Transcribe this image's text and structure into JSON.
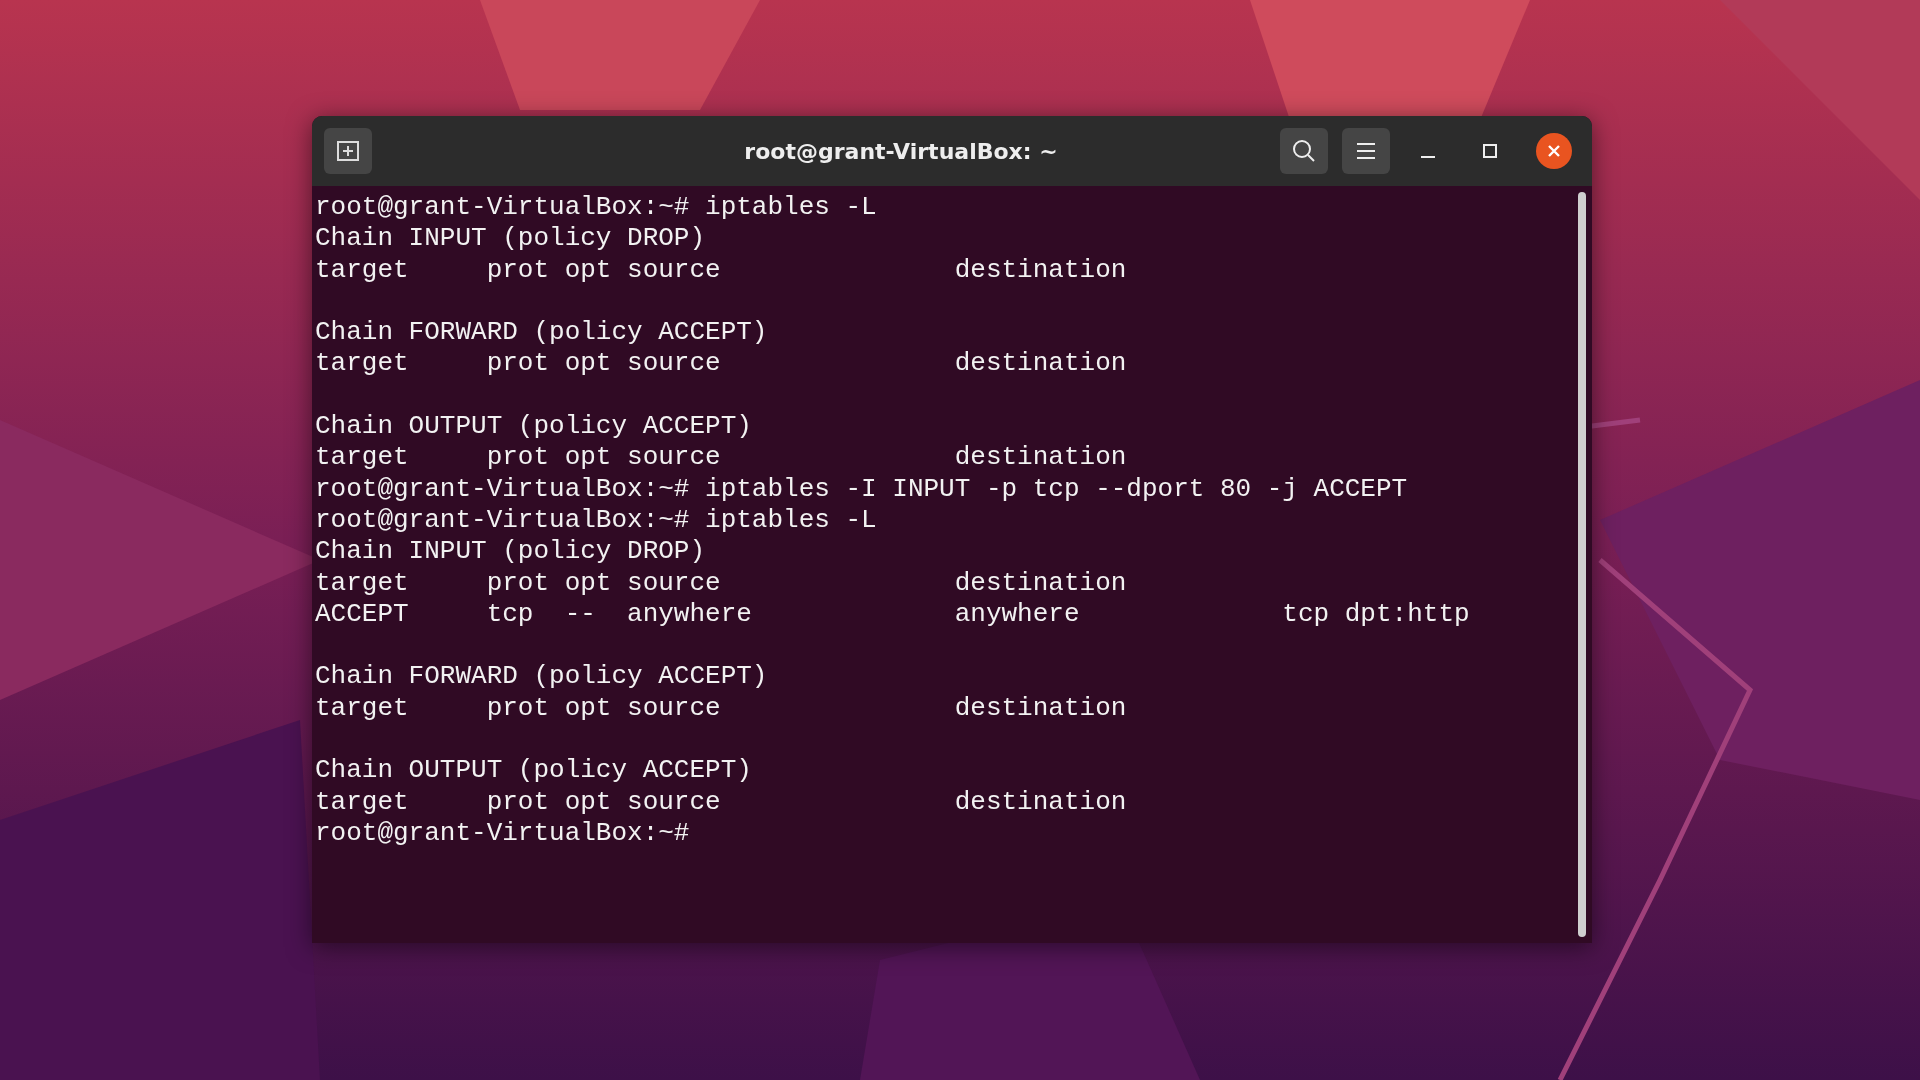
{
  "window": {
    "title": "root@grant-VirtualBox: ~"
  },
  "terminal": {
    "blocks": [
      [
        "root@grant-VirtualBox:~# iptables -L",
        "Chain INPUT (policy DROP)",
        "target     prot opt source               destination"
      ],
      [
        "Chain FORWARD (policy ACCEPT)",
        "target     prot opt source               destination"
      ],
      [
        "Chain OUTPUT (policy ACCEPT)",
        "target     prot opt source               destination",
        "root@grant-VirtualBox:~# iptables -I INPUT -p tcp --dport 80 -j ACCEPT",
        "root@grant-VirtualBox:~# iptables -L",
        "Chain INPUT (policy DROP)",
        "target     prot opt source               destination",
        "ACCEPT     tcp  --  anywhere             anywhere             tcp dpt:http"
      ],
      [
        "Chain FORWARD (policy ACCEPT)",
        "target     prot opt source               destination"
      ],
      [
        "Chain OUTPUT (policy ACCEPT)",
        "target     prot opt source               destination",
        "root@grant-VirtualBox:~#"
      ]
    ]
  }
}
